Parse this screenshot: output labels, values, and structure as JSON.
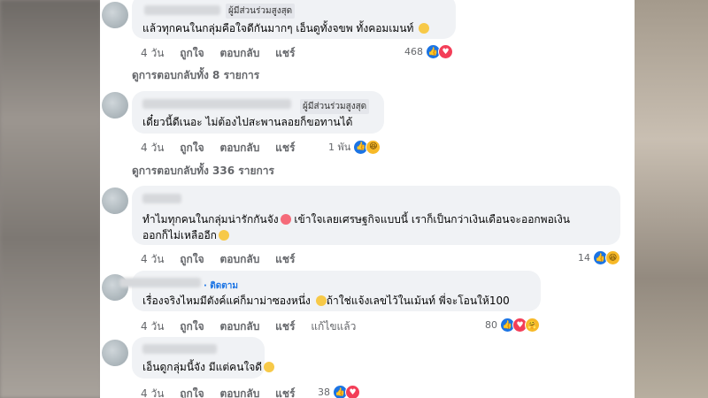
{
  "comments": [
    {
      "badge": "ผู้มีส่วนร่วมสูงสุด",
      "text": "แล้วทุกคนในกลุ่มคือใจดีกันมากๆ เอ็นดูทั้งจขพ ทั้งคอมเมนท์",
      "time": "4 วัน",
      "like": "ถูกใจ",
      "reply": "ตอบกลับ",
      "share": "แชร์",
      "count": "468"
    },
    {
      "badge": "ผู้มีส่วนร่วมสูงสุด",
      "text": "เดี๋ยวนี้ดีเนอะ ไม่ต้องไปสะพานลอยก็ขอทานได้",
      "time": "4 วัน",
      "like": "ถูกใจ",
      "reply": "ตอบกลับ",
      "share": "แชร์",
      "count": "1 พัน"
    },
    {
      "text1": "ทำไมทุกคนในกลุ่มน่ารักกันจัง",
      "text2": " เข้าใจเลยเศรษฐกิจแบบนี้ เราก็เป็นกว่าเงินเดือนจะออกพอเงิน",
      "text3": "ออกก็ไม่เหลืออีก",
      "time": "4 วัน",
      "like": "ถูกใจ",
      "reply": "ตอบกลับ",
      "share": "แชร์",
      "count": "14"
    },
    {
      "follow": "· ติดตาม",
      "text": "เรื่องจริงไหมมีตังค์แค่ก็มาม่าซองหนึ่ง",
      "text2": "ถ้าใช่แจ้งเลขไว้ในเม้นท์ พี่จะโอนให้100",
      "time": "4 วัน",
      "like": "ถูกใจ",
      "reply": "ตอบกลับ",
      "share": "แชร์",
      "edited": "แก้ไขแล้ว",
      "count": "80"
    },
    {
      "text": "เอ็นดูกลุ่มนี้จัง มีแต่คนใจดี",
      "time": "4 วัน",
      "like": "ถูกใจ",
      "reply": "ตอบกลับ",
      "share": "แชร์",
      "count": "38"
    }
  ],
  "view_replies_1": "ดูการตอบกลับทั้ง 8 รายการ",
  "view_replies_2": "ดูการตอบกลับทั้ง 336 รายการ",
  "icons": {
    "like": "thumbs-up-icon",
    "love": "heart-icon",
    "haha": "laughing-emoji-icon",
    "care": "care-emoji-icon"
  }
}
